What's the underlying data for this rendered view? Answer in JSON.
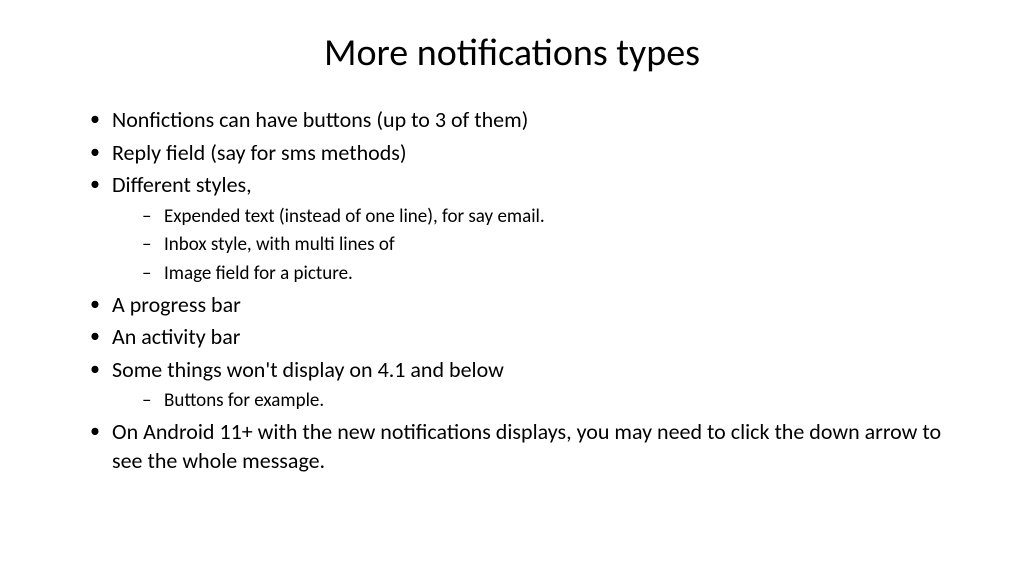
{
  "title": "More notifications types",
  "bullets": [
    {
      "text": "Nonfictions can have buttons (up to 3 of them)",
      "sub": []
    },
    {
      "text": "Reply field (say for sms methods)",
      "sub": []
    },
    {
      "text": "Different styles,",
      "sub": [
        "Expended text (instead of one line), for say email.",
        "Inbox style, with multi lines of",
        "Image field for a picture."
      ]
    },
    {
      "text": "A progress bar",
      "sub": []
    },
    {
      "text": "An activity bar",
      "sub": []
    },
    {
      "text": "Some things won't display on 4.1 and below",
      "sub": [
        "Buttons for example."
      ]
    },
    {
      "text": "On Android 11+ with the new notifications displays, you may need to click the down arrow to see the whole message.",
      "sub": []
    }
  ]
}
